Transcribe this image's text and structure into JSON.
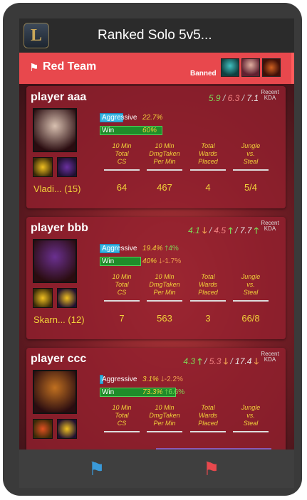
{
  "app": {
    "logo_letter": "L",
    "title": "Ranked Solo 5v5..."
  },
  "team": {
    "name": "Red Team",
    "banned_label": "Banned",
    "banned_icons": [
      "banned-champion-1",
      "banned-champion-2",
      "banned-champion-3"
    ]
  },
  "recent_kda_label": "Recent KDA",
  "stat_headers": [
    [
      "10 Min",
      "Total",
      "CS"
    ],
    [
      "10 Min",
      "DmgTaken",
      "Per Min"
    ],
    [
      "Total",
      "Wards",
      "Placed"
    ],
    [
      "Jungle",
      "vs.",
      "Steal"
    ]
  ],
  "bar_labels": {
    "aggressive": "Aggressive",
    "win": "Win"
  },
  "players": [
    {
      "name": "player aaa",
      "champion": "Vladi... (15)",
      "kda": {
        "k": "5.9",
        "d": "6.3",
        "a": "7.1",
        "k_trend": "",
        "d_trend": "",
        "a_trend": ""
      },
      "aggressive": {
        "value": 0.227,
        "text": "22.7%",
        "delta": ""
      },
      "win": {
        "value": 0.6,
        "text": "60%",
        "delta": ""
      },
      "stats": [
        "64",
        "467",
        "4",
        "5/4"
      ],
      "colors": {
        "portrait": "#d8c0b0",
        "spell1": "#f0c020",
        "spell2": "#6a30a0"
      }
    },
    {
      "name": "player bbb",
      "champion": "Skarn... (12)",
      "kda": {
        "k": "4.1",
        "d": "4.5",
        "a": "7.7",
        "k_trend": "down",
        "d_trend": "up",
        "a_trend": "up"
      },
      "aggressive": {
        "value": 0.194,
        "text": "19.4%",
        "delta": "4%",
        "delta_dir": "up"
      },
      "win": {
        "value": 0.4,
        "text": "40%",
        "delta": "-1.7%",
        "delta_dir": "down"
      },
      "stats": [
        "7",
        "563",
        "3",
        "66/8"
      ],
      "colors": {
        "portrait": "#6a3090",
        "spell1": "#f0c020",
        "spell2": "#f0c020"
      }
    },
    {
      "name": "player ccc",
      "champion": "",
      "kda": {
        "k": "4.3",
        "d": "5.3",
        "a": "17.4",
        "k_trend": "up",
        "d_trend": "down",
        "a_trend": "down"
      },
      "aggressive": {
        "value": 0.031,
        "text": "3.1%",
        "delta": "-2.2%",
        "delta_dir": "down"
      },
      "win": {
        "value": 0.733,
        "text": "73.3%",
        "delta": "6.6%",
        "delta_dir": "up"
      },
      "stats": [],
      "colors": {
        "portrait": "#c07020",
        "spell1": "#e05020",
        "spell2": "#f0c020"
      }
    }
  ],
  "nav": {
    "blue_flag": "blue-team-tab",
    "red_flag": "red-team-tab"
  }
}
